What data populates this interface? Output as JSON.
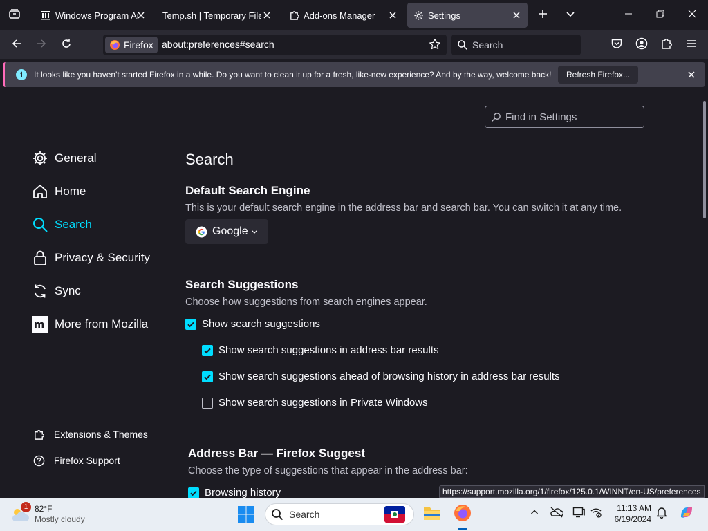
{
  "tabs": [
    {
      "title": "Windows Program Arc",
      "icon": "archive-favicon",
      "selected": false
    },
    {
      "title": "Temp.sh | Temporary File U",
      "icon": "none",
      "selected": false
    },
    {
      "title": "Add-ons Manager",
      "icon": "puzzle-icon",
      "selected": false
    },
    {
      "title": "Settings",
      "icon": "gear-icon",
      "selected": true
    }
  ],
  "navbar": {
    "identity_label": "Firefox",
    "url": "about:preferences#search",
    "search_placeholder": "Search"
  },
  "notification": {
    "message": "It looks like you haven't started Firefox in a while. Do you want to clean it up for a fresh, like-new experience? And by the way, welcome back!",
    "button_label": "Refresh Firefox..."
  },
  "find_placeholder": "Find in Settings",
  "sidebar": {
    "items": [
      {
        "label": "General",
        "icon": "gear-icon",
        "selected": false
      },
      {
        "label": "Home",
        "icon": "home-icon",
        "selected": false
      },
      {
        "label": "Search",
        "icon": "search-icon",
        "selected": true
      },
      {
        "label": "Privacy & Security",
        "icon": "lock-icon",
        "selected": false
      },
      {
        "label": "Sync",
        "icon": "sync-icon",
        "selected": false
      },
      {
        "label": "More from Mozilla",
        "icon": "mozilla-icon",
        "selected": false
      }
    ],
    "footer": [
      {
        "label": "Extensions & Themes",
        "icon": "puzzle-icon"
      },
      {
        "label": "Firefox Support",
        "icon": "help-icon"
      }
    ]
  },
  "main": {
    "title": "Search",
    "default_engine": {
      "heading": "Default Search Engine",
      "description": "This is your default search engine in the address bar and search bar. You can switch it at any time.",
      "selected": "Google"
    },
    "suggestions": {
      "heading": "Search Suggestions",
      "description": "Choose how suggestions from search engines appear.",
      "options": [
        {
          "label": "Show search suggestions",
          "checked": true
        },
        {
          "label": "Show search suggestions in address bar results",
          "checked": true
        },
        {
          "label": "Show search suggestions ahead of browsing history in address bar results",
          "checked": true
        },
        {
          "label": "Show search suggestions in Private Windows",
          "checked": false
        }
      ]
    },
    "address_bar": {
      "heading": "Address Bar — Firefox Suggest",
      "description": "Choose the type of suggestions that appear in the address bar:",
      "options": [
        {
          "label": "Browsing history",
          "checked": true
        }
      ]
    }
  },
  "status_url": "https://support.mozilla.org/1/firefox/125.0.1/WINNT/en-US/preferences",
  "taskbar": {
    "weather_temp": "82°F",
    "weather_desc": "Mostly cloudy",
    "weather_badge": "1",
    "search_label": "Search",
    "time": "11:13 AM",
    "date": "6/19/2024"
  },
  "colors": {
    "accent": "#00ddff",
    "background": "#1c1b22",
    "toolbar": "#2b2a33",
    "taskbar": "#e9eef4"
  }
}
